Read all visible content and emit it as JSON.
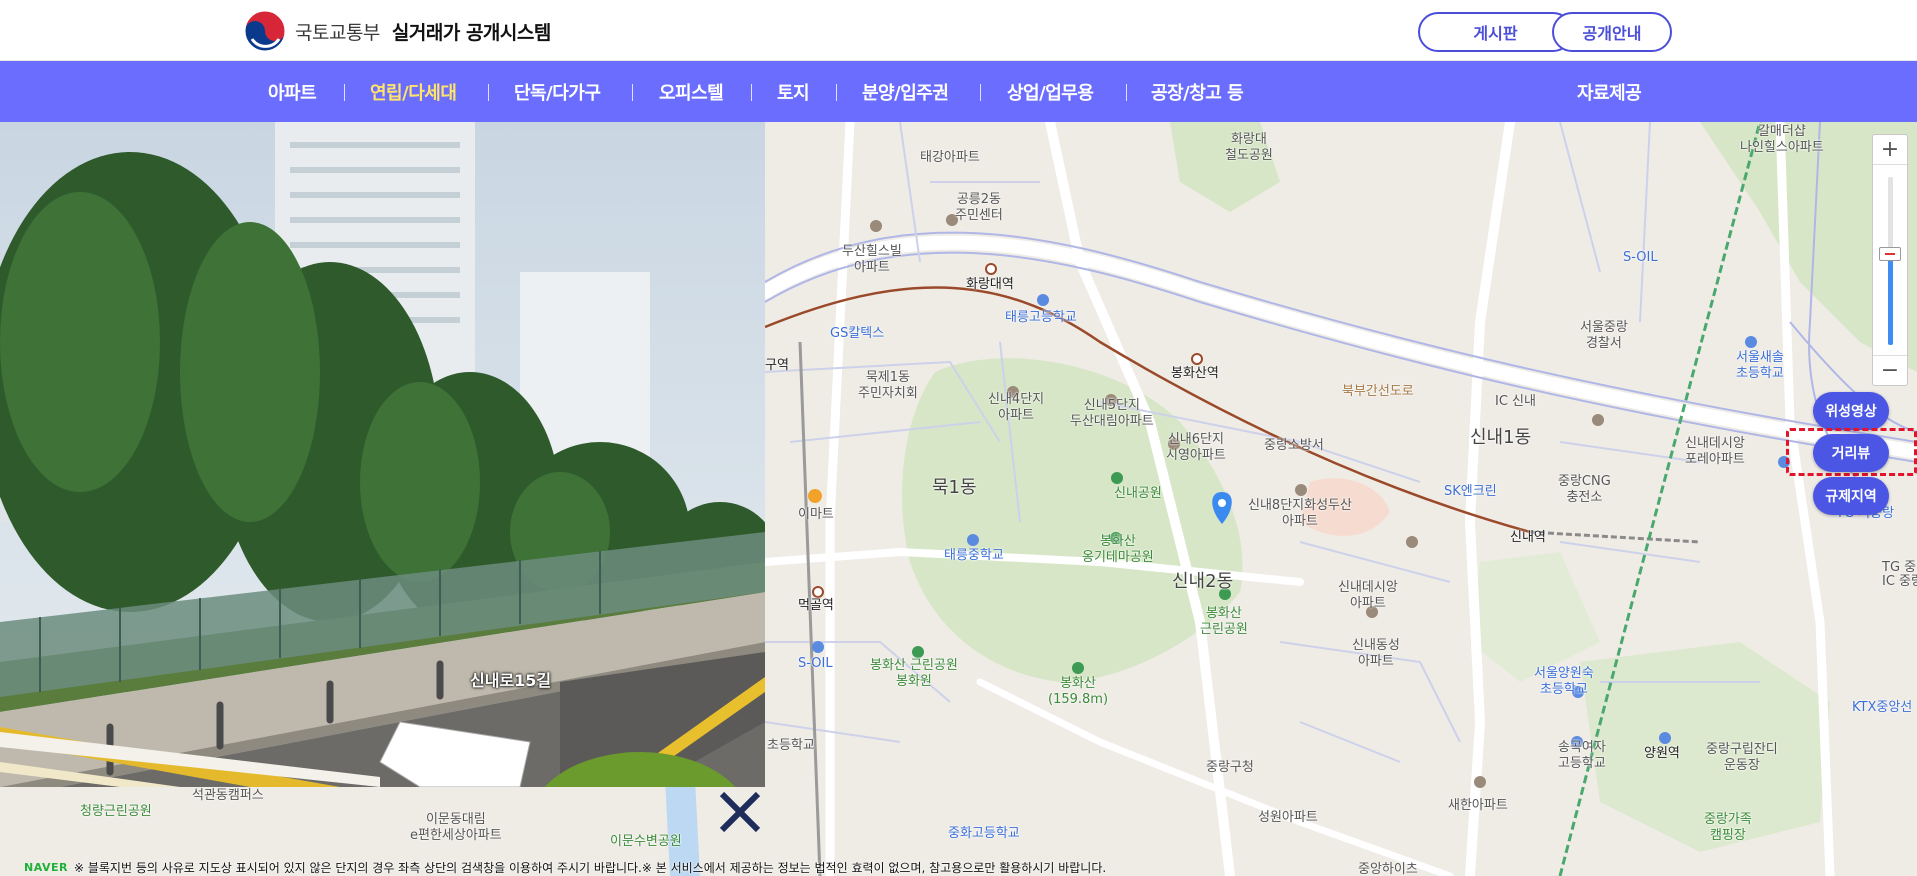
{
  "header": {
    "ministry": "국토교통부",
    "system_name": "실거래가 공개시스템",
    "board_button": "게시판",
    "info_button": "공개안내"
  },
  "nav": {
    "items": [
      {
        "label": "아파트"
      },
      {
        "label": "연립/다세대"
      },
      {
        "label": "단독/다가구"
      },
      {
        "label": "오피스텔"
      },
      {
        "label": "토지"
      },
      {
        "label": "분양/입주권"
      },
      {
        "label": "상업/업무용"
      },
      {
        "label": "공장/창고 등"
      }
    ],
    "active_index": 1,
    "data_provision": "자료제공"
  },
  "street_view": {
    "road_name": "신내로15길"
  },
  "map": {
    "controls": {
      "zoom_in": "+",
      "zoom_out": "−",
      "satellite": "위성영상",
      "street_view": "거리뷰",
      "regulation": "규제지역"
    },
    "labels": {
      "hwarang_park": "화랑대\n철도공원",
      "taegang_apt": "태강아파트",
      "galmae": "갈매더샵\n나인힐스아파트",
      "gongneung_center": "공릉2동\n주민센터",
      "dusan_hill": "두산힐스빌\n아파트",
      "hwarangdae_st": "화랑대역",
      "taereung_high": "태릉고등학교",
      "gs_caltex": "GS칼텍스",
      "soil_top": "S-OIL",
      "station_left": "구역",
      "mukje1": "묵제1동\n주민자치회",
      "sinnae4": "신내4단지\n아파트",
      "sinnae5": "신내5단지\n두산대림아파트",
      "bonghwasan_st": "봉화산역",
      "bukbu_road": "북부간선도로",
      "jungrang_police": "서울중랑\n경찰서",
      "ic_sinnae": "IC 신내",
      "seoul_saeseol": "서울새솔\n초등학교",
      "sinnae_desian_pore": "신내데시앙\n포레아파트",
      "sinnae6": "신내6단지\n시영아파트",
      "jungrang_fire": "중랑소방서",
      "sinnae1dong": "신내1동",
      "sk_energy": "SK엔크린",
      "jungrang_cng": "중랑CNG\n충전소",
      "tg_seojungrang": "TG 서중랑",
      "emart": "이마트",
      "mukdong1": "묵1동",
      "sinnae_park": "신내공원",
      "sinnae8": "신내8단지화성두산\n아파트",
      "sinnae_st": "신내역",
      "bonghwasan_theme": "봉화산\n옹기테마공원",
      "taereung_middle": "태릉중학교",
      "mukgol_st": "먹골역",
      "sinnae2dong": "신내2동",
      "sinnae_desian": "신내데시앙\n아파트",
      "bonghwasan_park": "봉화산\n근린공원",
      "soil_bottom": "S-OIL",
      "bonghwasan_geunrin": "봉화산 근린공원\n봉화원",
      "bonghwasan_peak": "봉화산\n(159.8m)",
      "sinnae_dongseong": "신내동성\n아파트",
      "seoul_yangwon": "서울양원숙\n초등학교",
      "ktx_jungang": "KTX중앙선",
      "songgok_high": "송곡여자\n고등학교",
      "yangwon_st": "양원역",
      "jungrang_forest": "중랑구립잔디\n운동장",
      "cheongryang_park": "청량근린공원",
      "seokgwan_campus": "석관동캠퍼스",
      "imun_daelim": "이문동대림\ne편한세상아파트",
      "imun_school": "이문수변공원",
      "junghwa_high": "중화고등학교",
      "jungrang_office": "중랑구청",
      "seongwon_apt": "성원아파트",
      "saehan_apt": "새한아파트",
      "jungang_hi": "중앙하이츠",
      "jungrang_camp": "중랑가족\n캠핑장",
      "school_left": "초등학교",
      "tg_jungrang": "TG 중랑",
      "ic_jungrang": "IC 중랑"
    }
  },
  "footer": {
    "naver": "NAVER",
    "notice": "※ 블록지번 등의 사유로 지도상 표시되어 있지 않은 단지의 경우 좌측 상단의 검색창을 이용하여 주시기 바랍니다.※ 본 서비스에서 제공하는 정보는 법적인 효력이 없으며, 참고용으로만 활용하시기 바랍니다."
  },
  "colors": {
    "nav_bg": "#6a6dfd",
    "nav_active": "#ffe46a",
    "button_blue": "#4b56e4",
    "highlight_red": "#e2132b"
  }
}
